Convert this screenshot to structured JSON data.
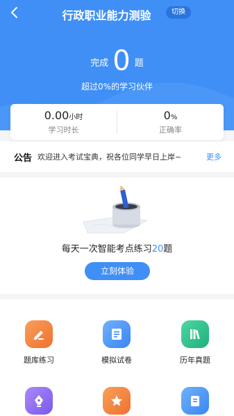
{
  "header": {
    "title": "行政职业能力测验",
    "switch_label": "切换"
  },
  "progress": {
    "prefix": "完成",
    "count": "0",
    "suffix": "题",
    "beat_text": "超过0%的学习伙伴"
  },
  "stats": [
    {
      "value": "0.00",
      "unit": "小时",
      "label": "学习时长"
    },
    {
      "value": "0",
      "unit": "%",
      "label": "正确率"
    }
  ],
  "notice": {
    "tag": "公告",
    "message": "欢迎进入考试宝典，祝各位同学早日上岸~",
    "more": "更多"
  },
  "daily": {
    "text_before": "每天一次智能考点练习",
    "count": "20",
    "text_after": "题",
    "button_label": "立刻体验"
  },
  "grid": [
    {
      "label": "题库练习",
      "icon": "edit-pencil-icon",
      "color": "#f47c3c"
    },
    {
      "label": "模拟试卷",
      "icon": "test-paper-icon",
      "color": "#3f8ff6"
    },
    {
      "label": "历年真题",
      "icon": "books-icon",
      "color": "#2bbf8a"
    },
    {
      "label": "",
      "icon": "pen-nib-icon",
      "color": "#8d6cf0"
    },
    {
      "label": "",
      "icon": "star-icon",
      "color": "#f47c3c"
    },
    {
      "label": "",
      "icon": "document-icon",
      "color": "#3f8ff6"
    }
  ],
  "colors": {
    "primary": "#3f8ff6"
  }
}
